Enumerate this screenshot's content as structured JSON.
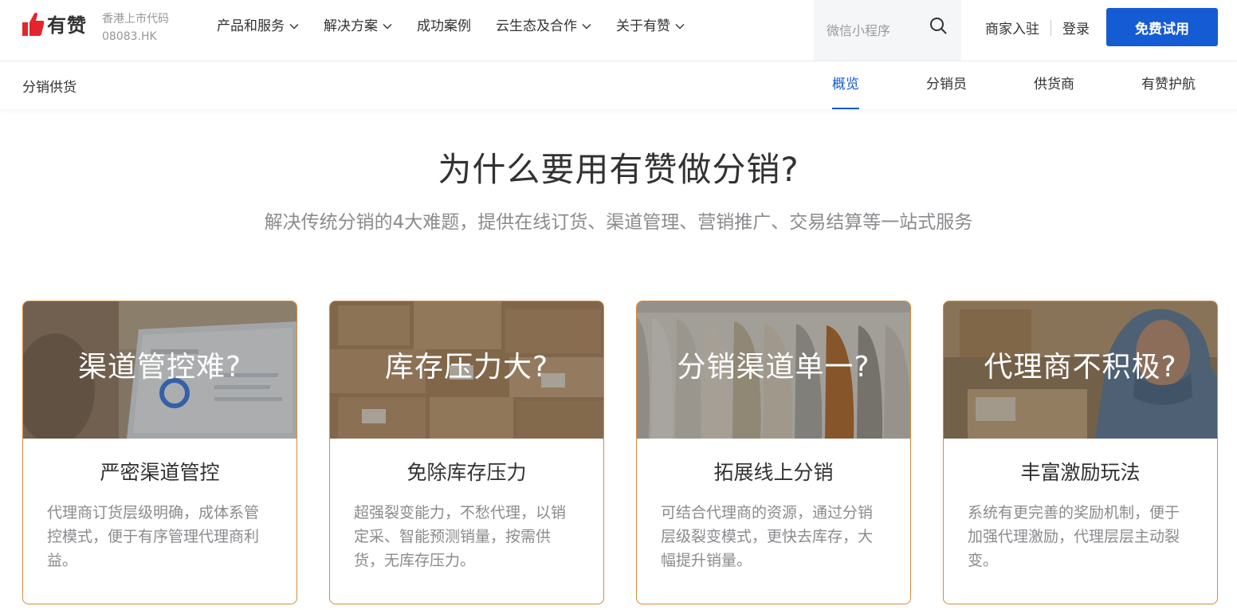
{
  "brand": {
    "name": "有赞",
    "stock_label": "香港上市代码",
    "stock_code": "08083.HK",
    "accent": "#155bd4",
    "logo_red": "#e3262e"
  },
  "nav": {
    "items": [
      {
        "label": "产品和服务",
        "dropdown": true
      },
      {
        "label": "解决方案",
        "dropdown": true
      },
      {
        "label": "成功案例",
        "dropdown": false
      },
      {
        "label": "云生态及合作",
        "dropdown": true
      },
      {
        "label": "关于有赞",
        "dropdown": true
      }
    ]
  },
  "search": {
    "placeholder": "微信小程序"
  },
  "header": {
    "merchant_label": "商家入驻",
    "login_label": "登录",
    "trial_label": "免费试用"
  },
  "subnav": {
    "title": "分销供货",
    "tabs": [
      {
        "label": "概览",
        "active": true
      },
      {
        "label": "分销员",
        "active": false
      },
      {
        "label": "供货商",
        "active": false
      },
      {
        "label": "有赞护航",
        "active": false
      }
    ]
  },
  "hero": {
    "title": "为什么要用有赞做分销?",
    "subtitle": "解决传统分销的4大难题，提供在线订货、渠道管理、营销推广、交易结算等一站式服务"
  },
  "cards": [
    {
      "question": "渠道管控难?",
      "title": "严密渠道管控",
      "desc": "代理商订货层级明确，成体系管控模式，便于有序管理代理商利益。"
    },
    {
      "question": "库存压力大?",
      "title": "免除库存压力",
      "desc": "超强裂变能力，不愁代理，以销定采、智能预测销量，按需供货，无库存压力。"
    },
    {
      "question": "分销渠道单一?",
      "title": "拓展线上分销",
      "desc": "可结合代理商的资源，通过分销层级裂变模式，更快去库存，大幅提升销量。"
    },
    {
      "question": "代理商不积极?",
      "title": "丰富激励玩法",
      "desc": "系统有更完善的奖励机制，便于加强代理激励，代理层层主动裂变。"
    }
  ]
}
